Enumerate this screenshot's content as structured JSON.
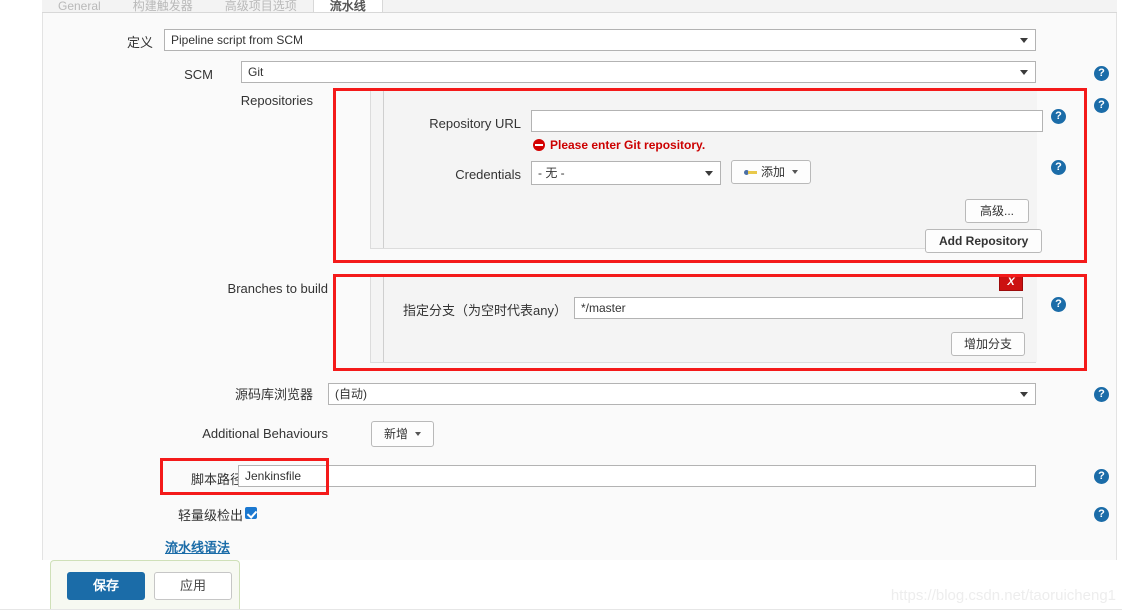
{
  "tabs": [
    {
      "label": "General",
      "active": false
    },
    {
      "label": "构建触发器",
      "active": false
    },
    {
      "label": "高级项目选项",
      "active": false
    },
    {
      "label": "流水线",
      "active": true
    }
  ],
  "definition": {
    "label": "定义",
    "value": "Pipeline script from SCM"
  },
  "scm": {
    "label": "SCM",
    "value": "Git"
  },
  "repositories": {
    "label": "Repositories",
    "repository_url": {
      "label": "Repository URL",
      "value": "",
      "placeholder": ""
    },
    "error": {
      "icon": "error-circle-icon",
      "text": "Please enter Git repository."
    },
    "credentials": {
      "label": "Credentials",
      "value": "- 无 -",
      "add_button": "添加",
      "add_icon": "key-icon"
    },
    "advanced_button": "高级...",
    "add_repository_button": "Add Repository"
  },
  "branches": {
    "label": "Branches to build",
    "branch_specifier": {
      "label": "指定分支（为空时代表any）",
      "value": "*/master"
    },
    "delete_button": "X",
    "add_branch_button": "增加分支"
  },
  "repo_browser": {
    "label": "源码库浏览器",
    "value": "(自动)"
  },
  "additional_behaviours": {
    "label": "Additional Behaviours",
    "add_button": "新增"
  },
  "script_path": {
    "label": "脚本路径",
    "value": "Jenkinsfile"
  },
  "lightweight_checkout": {
    "label": "轻量级检出",
    "checked": true
  },
  "pipeline_syntax_link": "流水线语法",
  "footer": {
    "save_button": "保存",
    "apply_button": "应用"
  },
  "watermark": "https://blog.csdn.net/taoruicheng1",
  "help_icon_glyph": "?",
  "colors": {
    "accent": "#1b6ca8",
    "error": "#cc0000",
    "highlight": "#f41a1a",
    "delete": "#cc1111"
  }
}
